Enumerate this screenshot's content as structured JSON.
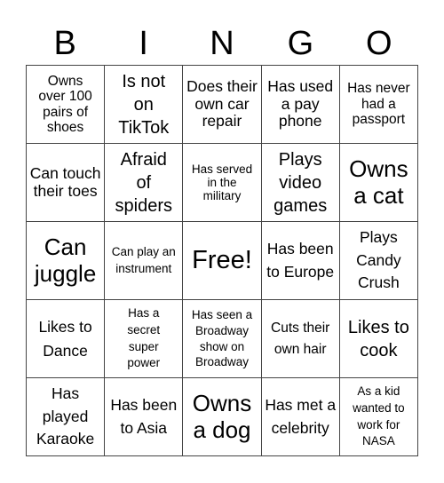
{
  "header": {
    "letters": [
      "B",
      "I",
      "N",
      "G",
      "O"
    ]
  },
  "cells": [
    [
      "Owns over 100 pairs of shoes",
      "Is not on TikTok",
      "Does their own car repair",
      "Has used a pay phone",
      "Has never had a passport"
    ],
    [
      "Can touch their toes",
      "Afraid of spiders",
      "Has served in the military",
      "Plays video games",
      "Owns a cat"
    ],
    [
      "Can juggle",
      "Can play an instrument",
      "Free!",
      "Has been to Europe",
      "Plays Candy Crush"
    ],
    [
      "Likes to Dance",
      "Has a secret super power",
      "Has seen a Broadway show on Broadway",
      "Cuts their own hair",
      "Likes to cook"
    ],
    [
      "Has played Karaoke",
      "Has been to Asia",
      "Owns a dog",
      "Has met a celebrity",
      "As a kid wanted to work for NASA"
    ]
  ]
}
